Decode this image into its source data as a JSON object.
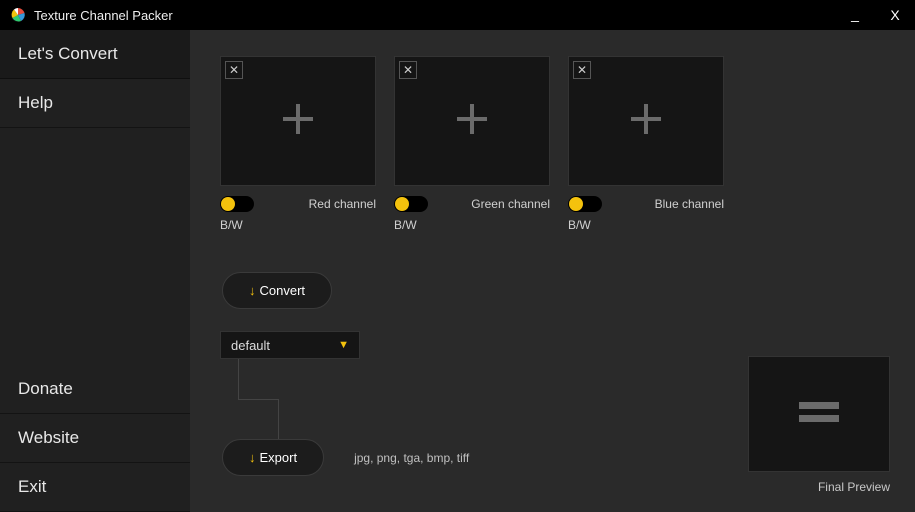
{
  "titlebar": {
    "title": "Texture Channel Packer",
    "minimize": "_",
    "close": "X"
  },
  "sidebar": {
    "top": [
      {
        "label": "Let's Convert"
      },
      {
        "label": "Help"
      }
    ],
    "bottom": [
      {
        "label": "Donate"
      },
      {
        "label": "Website"
      },
      {
        "label": "Exit"
      }
    ]
  },
  "channels": [
    {
      "label": "Red channel",
      "bw": "B/W"
    },
    {
      "label": "Green channel",
      "bw": "B/W"
    },
    {
      "label": "Blue channel",
      "bw": "B/W"
    }
  ],
  "convert": {
    "label": "Convert"
  },
  "presetSelect": {
    "value": "default"
  },
  "export": {
    "label": "Export",
    "formats": "jpg, png, tga, bmp, tiff"
  },
  "preview": {
    "label": "Final Preview"
  },
  "colors": {
    "accent": "#f4c20d"
  }
}
